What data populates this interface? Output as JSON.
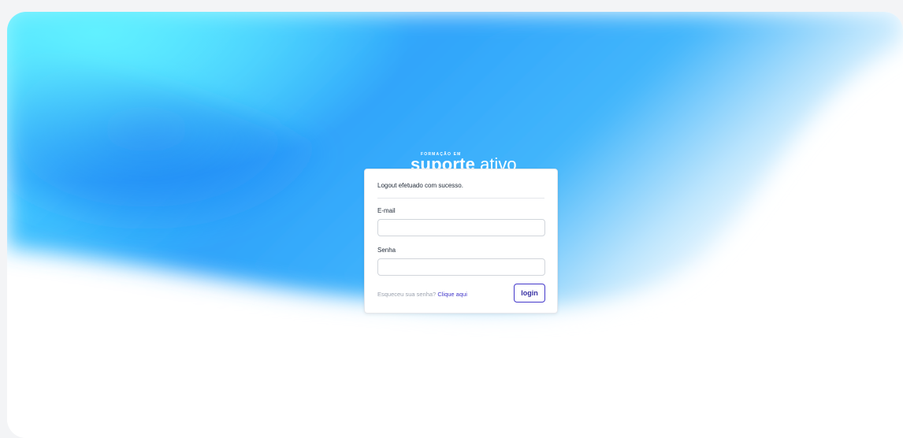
{
  "brand": {
    "small_text": "FORMAÇÃO EM",
    "name_bold": "suporte",
    "name_light": "ativo"
  },
  "login": {
    "status_message": "Logout efetuado com sucesso.",
    "email_label": "E-mail",
    "email_value": "",
    "password_label": "Senha",
    "password_value": "",
    "forgot_text": "Esqueceu sua senha?",
    "forgot_link": "Clique aqui",
    "submit_label": "login"
  },
  "colors": {
    "accent": "#4338ca",
    "background_blue": "#1a8cf5",
    "background_cyan": "#5cf0ff"
  }
}
